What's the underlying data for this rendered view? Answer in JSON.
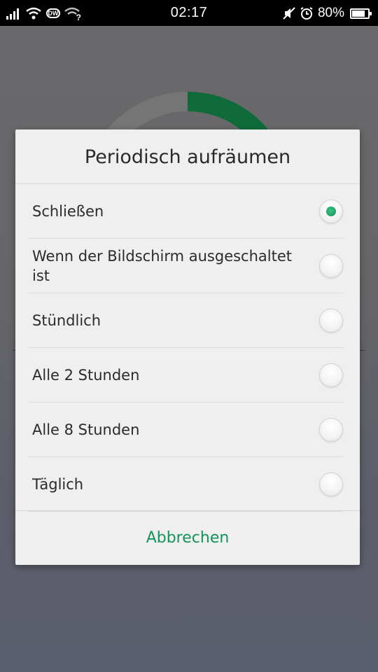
{
  "status_bar": {
    "time": "02:17",
    "battery_text": "80%",
    "battery_level": 0.8,
    "icons": [
      "signal-icon",
      "wifi-icon",
      "dw-icon",
      "wifi-unknown-icon",
      "mute-icon",
      "alarm-icon",
      "battery-icon"
    ],
    "dw_label": "DW",
    "wifi_q": "?"
  },
  "dialog": {
    "title": "Periodisch aufräumen",
    "options": [
      {
        "label": "Schließen",
        "selected": true
      },
      {
        "label": "Wenn der Bildschirm ausgeschaltet ist",
        "selected": false
      },
      {
        "label": "Stündlich",
        "selected": false
      },
      {
        "label": "Alle 2 Stunden",
        "selected": false
      },
      {
        "label": "Alle 8 Stunden",
        "selected": false
      },
      {
        "label": "Täglich",
        "selected": false
      }
    ],
    "cancel_label": "Abbrechen"
  },
  "colors": {
    "accent": "#15935a",
    "ring_progress": "#0f6b3a",
    "ring_track": "#7c7c7c"
  }
}
